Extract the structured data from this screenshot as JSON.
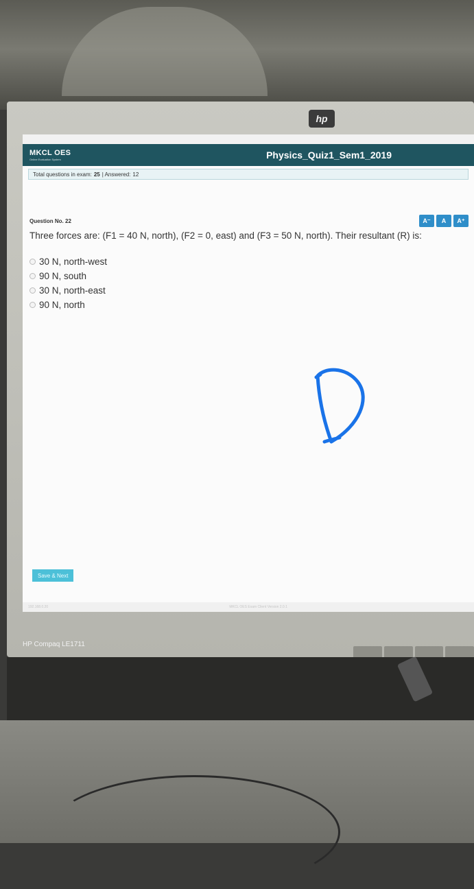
{
  "monitor": {
    "logo_text": "hp",
    "model": "HP Compaq LE1711"
  },
  "app": {
    "brand": "MKCL OES",
    "brand_sub": "Online Evaluation System",
    "exam_title": "Physics_Quiz1_Sem1_2019",
    "header_color": "#1f5560"
  },
  "stats": {
    "total_label": "Total questions in exam:",
    "total_value": "25",
    "answered_label": "| Answered:",
    "answered_value": "12"
  },
  "question": {
    "number_label": "Question No. 22",
    "text": "Three forces are: (F1 = 40 N, north), (F2 = 0, east) and (F3 = 50 N, north). Their resultant (R) is:",
    "options": [
      "30 N, north-west",
      "90 N, south",
      "30 N, north-east",
      "90 N, north"
    ]
  },
  "font_controls": {
    "decrease": "A⁻",
    "normal": "A",
    "increase": "A⁺",
    "color": "#2f8ec9"
  },
  "actions": {
    "save_next": "Save & Next"
  },
  "footer": {
    "left": "192.168.0.20",
    "center": "MKCL OES Exam Client Version 2.0.1"
  },
  "annotation": {
    "handwritten_letter": "D",
    "color": "#1a73e8"
  }
}
